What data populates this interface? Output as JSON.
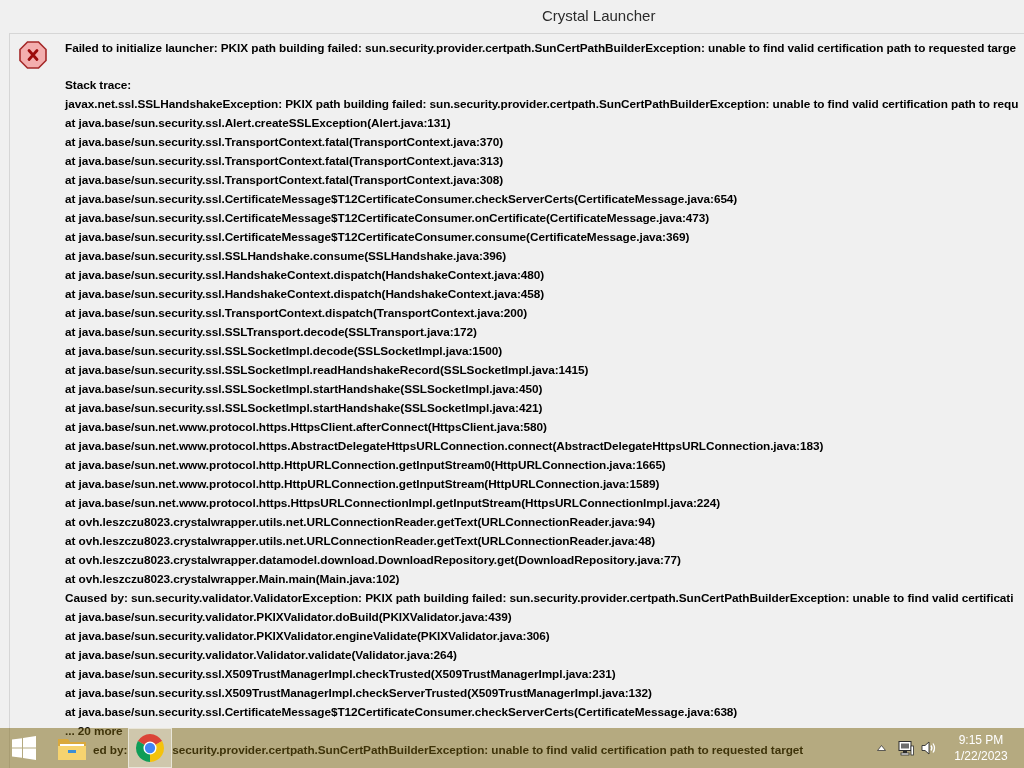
{
  "window": {
    "title": "Crystal Launcher"
  },
  "dialog": {
    "message": "Failed to initialize launcher: PKIX path building failed: sun.security.provider.certpath.SunCertPathBuilderException: unable to find valid certification path to requested targe",
    "stack_trace_label": "Stack trace:",
    "stack_trace": [
      "javax.net.ssl.SSLHandshakeException: PKIX path building failed: sun.security.provider.certpath.SunCertPathBuilderException: unable to find valid certification path to requ",
      "at java.base/sun.security.ssl.Alert.createSSLException(Alert.java:131)",
      "at java.base/sun.security.ssl.TransportContext.fatal(TransportContext.java:370)",
      "at java.base/sun.security.ssl.TransportContext.fatal(TransportContext.java:313)",
      "at java.base/sun.security.ssl.TransportContext.fatal(TransportContext.java:308)",
      "at java.base/sun.security.ssl.CertificateMessage$T12CertificateConsumer.checkServerCerts(CertificateMessage.java:654)",
      "at java.base/sun.security.ssl.CertificateMessage$T12CertificateConsumer.onCertificate(CertificateMessage.java:473)",
      "at java.base/sun.security.ssl.CertificateMessage$T12CertificateConsumer.consume(CertificateMessage.java:369)",
      "at java.base/sun.security.ssl.SSLHandshake.consume(SSLHandshake.java:396)",
      "at java.base/sun.security.ssl.HandshakeContext.dispatch(HandshakeContext.java:480)",
      "at java.base/sun.security.ssl.HandshakeContext.dispatch(HandshakeContext.java:458)",
      "at java.base/sun.security.ssl.TransportContext.dispatch(TransportContext.java:200)",
      "at java.base/sun.security.ssl.SSLTransport.decode(SSLTransport.java:172)",
      "at java.base/sun.security.ssl.SSLSocketImpl.decode(SSLSocketImpl.java:1500)",
      "at java.base/sun.security.ssl.SSLSocketImpl.readHandshakeRecord(SSLSocketImpl.java:1415)",
      "at java.base/sun.security.ssl.SSLSocketImpl.startHandshake(SSLSocketImpl.java:450)",
      "at java.base/sun.security.ssl.SSLSocketImpl.startHandshake(SSLSocketImpl.java:421)",
      "at java.base/sun.net.www.protocol.https.HttpsClient.afterConnect(HttpsClient.java:580)",
      "at java.base/sun.net.www.protocol.https.AbstractDelegateHttpsURLConnection.connect(AbstractDelegateHttpsURLConnection.java:183)",
      "at java.base/sun.net.www.protocol.http.HttpURLConnection.getInputStream0(HttpURLConnection.java:1665)",
      "at java.base/sun.net.www.protocol.http.HttpURLConnection.getInputStream(HttpURLConnection.java:1589)",
      "at java.base/sun.net.www.protocol.https.HttpsURLConnectionImpl.getInputStream(HttpsURLConnectionImpl.java:224)",
      "at ovh.leszczu8023.crystalwrapper.utils.net.URLConnectionReader.getText(URLConnectionReader.java:94)",
      "at ovh.leszczu8023.crystalwrapper.utils.net.URLConnectionReader.getText(URLConnectionReader.java:48)",
      "at ovh.leszczu8023.crystalwrapper.datamodel.download.DownloadRepository.get(DownloadRepository.java:77)",
      "at ovh.leszczu8023.crystalwrapper.Main.main(Main.java:102)",
      "Caused by: sun.security.validator.ValidatorException: PKIX path building failed: sun.security.provider.certpath.SunCertPathBuilderException: unable to find valid certificati",
      "at java.base/sun.security.validator.PKIXValidator.doBuild(PKIXValidator.java:439)",
      "at java.base/sun.security.validator.PKIXValidator.engineValidate(PKIXValidator.java:306)",
      "at java.base/sun.security.validator.Validator.validate(Validator.java:264)",
      "at java.base/sun.security.ssl.X509TrustManagerImpl.checkTrusted(X509TrustManagerImpl.java:231)",
      "at java.base/sun.security.ssl.X509TrustManagerImpl.checkServerTrusted(X509TrustManagerImpl.java:132)",
      "at java.base/sun.security.ssl.CertificateMessage$T12CertificateConsumer.checkServerCerts(CertificateMessage.java:638)",
      "... 20 more"
    ],
    "covered_line": [
      "ed by:",
      "security.provider.certpath.SunCertPathBuilderException: unable to find valid certification path to requested target"
    ]
  },
  "taskbar": {
    "apps": [
      {
        "kind": "folder",
        "active": false
      },
      {
        "kind": "browser",
        "active": true
      }
    ],
    "clock": {
      "time": "9:15 PM",
      "date": "1/22/2023"
    }
  }
}
